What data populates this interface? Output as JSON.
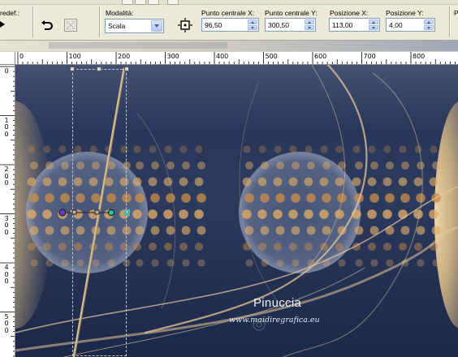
{
  "toolbar": {
    "preset_label": "redef.:",
    "mode_label": "Modalità:",
    "mode_value": "Scala",
    "center_x_label": "Punto centrale X:",
    "center_x_value": "96,50",
    "center_y_label": "Punto centrale Y:",
    "center_y_value": "300,50",
    "pos_x_label": "Posizione X:",
    "pos_x_value": "113,00",
    "pos_y_label": "Posizione Y:",
    "pos_y_value": "4,00",
    "icons": [
      "undo-icon",
      "reset-icon",
      "center-on-canvas-icon"
    ]
  },
  "rulers": {
    "unit": "px",
    "horizontal_labels": [
      "0",
      "100",
      "200",
      "300",
      "400",
      "500",
      "600",
      "700",
      "800"
    ],
    "vertical_labels": [
      "0",
      "100",
      "200",
      "300",
      "400",
      "500"
    ]
  },
  "canvas": {
    "watermark_name": "Pinuccia",
    "watermark_url": "www.maidiregrafica.eu",
    "colors": {
      "background_navy": "#1f2c4c",
      "glow_beige": "#e8c99a",
      "dot_orange": "#d9a05a",
      "selection_gray": "#c8c8c8"
    }
  }
}
